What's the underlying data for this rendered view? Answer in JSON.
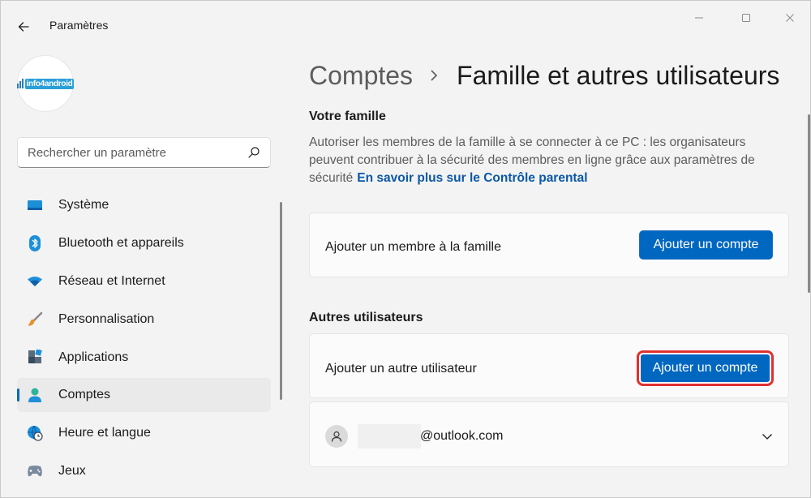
{
  "window": {
    "app_title": "Paramètres",
    "icons": {
      "back": "arrow-left-icon",
      "minimize": "minimize-icon",
      "maximize": "maximize-icon",
      "close": "close-icon"
    }
  },
  "sidebar": {
    "logo_text": "info4android",
    "search": {
      "placeholder": "Rechercher un paramètre",
      "icon": "search-icon"
    },
    "items": [
      {
        "label": "Système",
        "icon": "monitor-icon",
        "active": false
      },
      {
        "label": "Bluetooth et appareils",
        "icon": "bluetooth-icon",
        "active": false
      },
      {
        "label": "Réseau et Internet",
        "icon": "wifi-icon",
        "active": false
      },
      {
        "label": "Personnalisation",
        "icon": "brush-icon",
        "active": false
      },
      {
        "label": "Applications",
        "icon": "apps-icon",
        "active": false
      },
      {
        "label": "Comptes",
        "icon": "account-icon",
        "active": true
      },
      {
        "label": "Heure et langue",
        "icon": "globe-clock-icon",
        "active": false
      },
      {
        "label": "Jeux",
        "icon": "gamepad-icon",
        "active": false
      }
    ]
  },
  "main": {
    "breadcrumb": {
      "parent": "Comptes",
      "current": "Famille et autres utilisateurs"
    },
    "family": {
      "title": "Votre famille",
      "description": "Autoriser les membres de la famille à se connecter à ce PC : les organisateurs peuvent contribuer à la sécurité des membres en ligne grâce aux paramètres de sécurité",
      "link": "En savoir plus sur le Contrôle parental",
      "add_member_label": "Ajouter un membre à la famille",
      "add_member_button": "Ajouter un compte"
    },
    "others": {
      "title": "Autres utilisateurs",
      "add_user_label": "Ajouter un autre utilisateur",
      "add_user_button": "Ajouter un compte",
      "user_email": "@outlook.com"
    }
  },
  "colors": {
    "accent": "#0067c0",
    "highlight": "#e0312f",
    "link": "#0a58a8"
  }
}
